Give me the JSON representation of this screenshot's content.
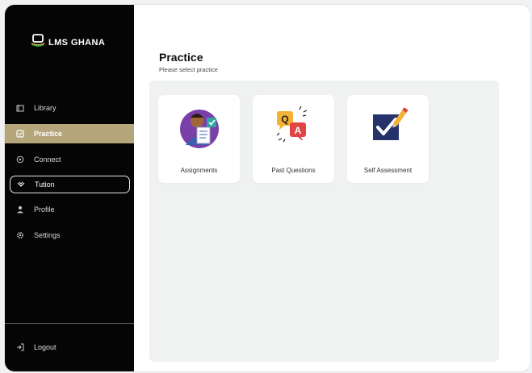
{
  "app": {
    "logo_text": "LMS GHANA"
  },
  "sidebar": {
    "items": [
      {
        "label": "Library",
        "icon": "library-icon"
      },
      {
        "label": "Practice",
        "icon": "practice-icon",
        "active": true
      },
      {
        "label": "Connect",
        "icon": "connect-icon"
      },
      {
        "label": "Tution",
        "icon": "tuition-icon",
        "outlined": true
      },
      {
        "label": "Profile",
        "icon": "profile-icon"
      },
      {
        "label": "Settings",
        "icon": "settings-icon"
      }
    ],
    "logout_label": "Logout"
  },
  "main": {
    "title": "Practice",
    "subtitle": "Please select practice",
    "cards": [
      {
        "label": "Assignments",
        "icon": "assignment-illustration-icon"
      },
      {
        "label": "Past Questions",
        "icon": "qa-speech-bubbles-icon"
      },
      {
        "label": "Self Assessment",
        "icon": "checkbox-pencil-icon"
      }
    ]
  },
  "colors": {
    "sidebar_bg": "#050505",
    "active_item_bg": "#b4a57a",
    "panel_bg": "#f0f1f1",
    "accent_yellow": "#f2b233",
    "accent_red": "#e04444",
    "accent_navy": "#25336b"
  }
}
